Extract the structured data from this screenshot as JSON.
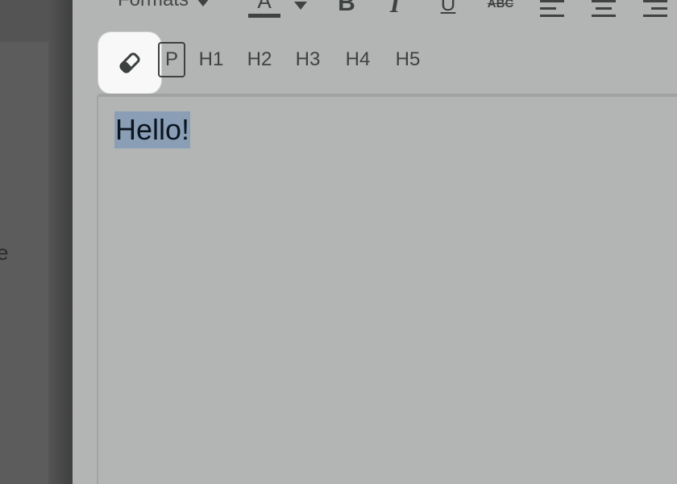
{
  "background_app": {
    "text_fragment": "e"
  },
  "toolbar": {
    "formats_label": "Formats",
    "font_color_letter": "A",
    "bold_label": "B",
    "italic_label": "I",
    "underline_label": "U",
    "strikethrough_label": "ABC",
    "paragraph_label": "P",
    "headings": [
      "H1",
      "H2",
      "H3",
      "H4",
      "H5"
    ]
  },
  "editor": {
    "content_text": "Hello!"
  },
  "icons": {
    "clear_format": "eraser-icon",
    "dropdown": "caret-down-icon",
    "align_left": "align-left-icon",
    "align_center": "align-center-icon",
    "align_right": "align-right-icon"
  },
  "colors": {
    "selection": "#8a9fb6",
    "highlight_button": "#f7f8f7"
  }
}
